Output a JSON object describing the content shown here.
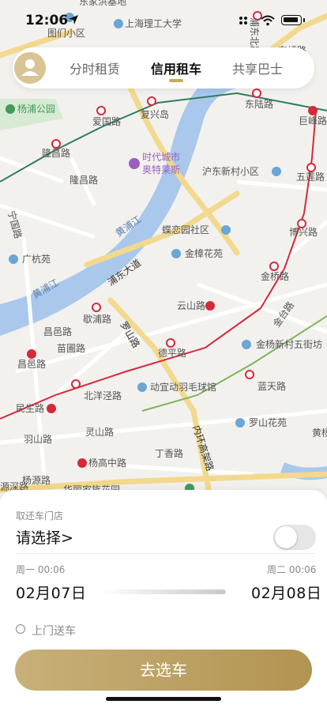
{
  "status_bar": {
    "time": "12:06"
  },
  "header": {
    "tabs": [
      {
        "label": "分时租赁",
        "active": false
      },
      {
        "label": "信用租车",
        "active": true
      },
      {
        "label": "共享巴士",
        "active": false
      }
    ]
  },
  "map": {
    "labels": {
      "jiasi": "东家洪基地",
      "tumen": "图们小区",
      "sut": "上海理工大学",
      "pudong": "浦东北路",
      "dongxin": "东靖路",
      "yangpu": "杨浦公园",
      "aiguo": "爱国路",
      "fuxing": "复兴岛",
      "dongluo": "东陆路",
      "jufeng": "巨峰路",
      "longchang": "隆昌路",
      "longchang2": "隆昌路",
      "shidai": "时代城市",
      "outlets": "奥特莱斯",
      "hudong": "沪东新村小区",
      "wulian": "五莲路",
      "ningguo": "宁国路",
      "huangpujiang1": "黄浦江",
      "huangpujiang2": "黄浦江",
      "dieluan": "蝶恋园社区",
      "boxing": "博兴路",
      "guanghang": "广杭苑",
      "jinzhang": "金樟花苑",
      "pudongdadao": "浦东大道",
      "jinqiao": "金桥路",
      "yunshan": "云山路",
      "jintai": "金台路",
      "xinpu": "歇浦路",
      "changyi": "昌邑路",
      "miaopu": "苗圃路",
      "luoshan": "罗山路",
      "deping": "德平路",
      "jinyang": "金杨新村五街坊",
      "changyi2": "昌邑路",
      "beiyang": "北洋泾路",
      "dongyi": "动宜动羽毛球馆",
      "lantian": "蓝天路",
      "minsheng": "民生路",
      "yushan": "羽山路",
      "lingshan": "灵山路",
      "luoshanhuayuan": "罗山花苑",
      "huangyang": "黄杨",
      "yuanshen": "源深路",
      "neihuan": "内环高架路",
      "dingxiang": "丁香路",
      "yanggao": "杨高中路",
      "yangyuan": "杨源路",
      "huali": "华丽家族花园"
    }
  },
  "sheet": {
    "store_label": "取还车门店",
    "store_value": "请选择>",
    "pickup_day": "周一 00:06",
    "pickup_date": "02月07日",
    "return_day": "周二 00:06",
    "return_date": "02月08日",
    "door_delivery": "上门送车",
    "submit": "去选车"
  },
  "colors": {
    "accent": "#c9a961",
    "water": "#a9c8ec",
    "map_bg": "#f2f1ee",
    "road_major": "#f3d98d",
    "metro_red": "#d6293a",
    "metro_green": "#2f7d5f"
  }
}
